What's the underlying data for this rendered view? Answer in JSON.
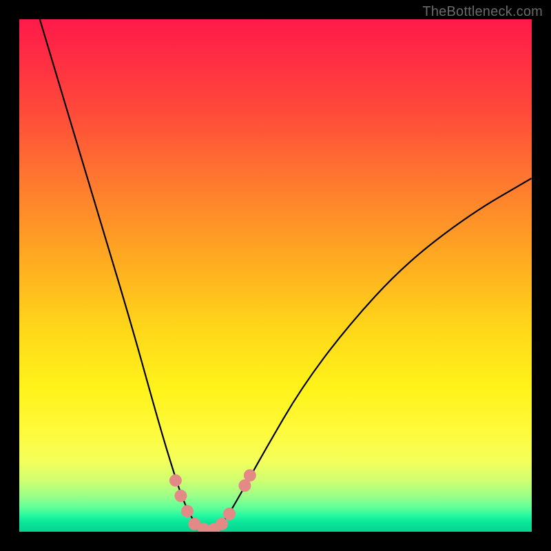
{
  "watermark": "TheBottleneck.com",
  "colors": {
    "background": "#000000",
    "curve_stroke": "#000000",
    "marker_fill": "#e48a86",
    "marker_stroke": "#c06a66",
    "gradient_top": "#ff1a4a",
    "gradient_bottom": "#05d690"
  },
  "chart_data": {
    "type": "line",
    "title": "",
    "xlabel": "",
    "ylabel": "",
    "xlim": [
      0,
      100
    ],
    "ylim": [
      0,
      100
    ],
    "curve_minimum_x": 36,
    "curve": [
      {
        "x": 4,
        "y": 100
      },
      {
        "x": 10,
        "y": 80
      },
      {
        "x": 16,
        "y": 60
      },
      {
        "x": 22,
        "y": 40
      },
      {
        "x": 27,
        "y": 22
      },
      {
        "x": 30,
        "y": 12
      },
      {
        "x": 32,
        "y": 6
      },
      {
        "x": 34,
        "y": 2
      },
      {
        "x": 36,
        "y": 0
      },
      {
        "x": 38,
        "y": 0
      },
      {
        "x": 40,
        "y": 2
      },
      {
        "x": 43,
        "y": 7
      },
      {
        "x": 48,
        "y": 16
      },
      {
        "x": 55,
        "y": 28
      },
      {
        "x": 64,
        "y": 40
      },
      {
        "x": 75,
        "y": 52
      },
      {
        "x": 88,
        "y": 62
      },
      {
        "x": 100,
        "y": 69
      }
    ],
    "markers": [
      {
        "x": 30.5,
        "y": 10
      },
      {
        "x": 31.5,
        "y": 7
      },
      {
        "x": 32.8,
        "y": 4
      },
      {
        "x": 34.2,
        "y": 1.5
      },
      {
        "x": 36.0,
        "y": 0.5
      },
      {
        "x": 38.0,
        "y": 0.5
      },
      {
        "x": 39.5,
        "y": 1.5
      },
      {
        "x": 41.0,
        "y": 3.5
      },
      {
        "x": 44.0,
        "y": 9
      },
      {
        "x": 45.0,
        "y": 11
      }
    ]
  }
}
